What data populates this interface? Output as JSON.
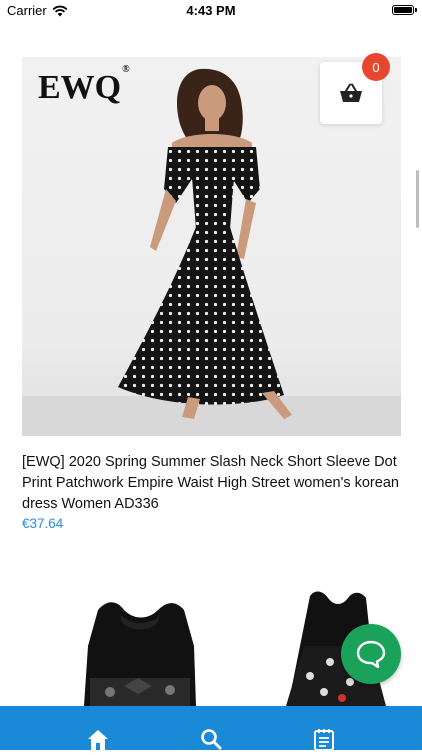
{
  "status_bar": {
    "carrier": "Carrier",
    "time": "4:43 PM"
  },
  "product": {
    "brand": "EWQ",
    "brand_mark": "®",
    "title": "[EWQ] 2020 Spring Summer Slash Neck Short Sleeve Dot Print Patchwork Empire Waist High Street women's korean dress Women AD336",
    "price": "€37.64"
  },
  "cart": {
    "count": "0",
    "icon": "shopping-basket-icon"
  },
  "chat": {
    "icon": "chat-bubble-icon"
  },
  "tab_bar": {
    "items": [
      {
        "icon": "home-icon"
      },
      {
        "icon": "search-icon"
      },
      {
        "icon": "notes-icon"
      }
    ]
  },
  "colors": {
    "accent": "#1a8ad6",
    "price": "#2a8de0",
    "badge": "#e8472f",
    "chat": "#1aa15a"
  }
}
